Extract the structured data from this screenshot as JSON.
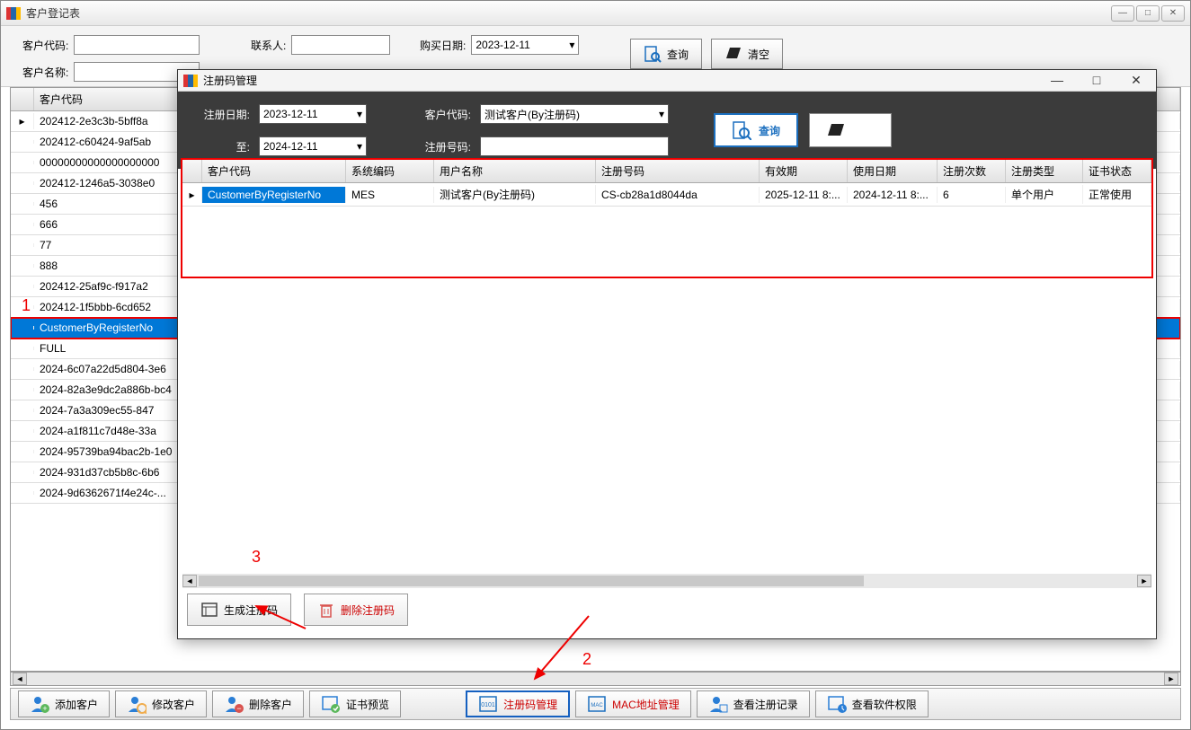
{
  "main_window": {
    "title": "客户登记表",
    "search": {
      "customer_code_label": "客户代码:",
      "contact_label": "联系人:",
      "purchase_date_label": "购买日期:",
      "purchase_date_value": "2023-12-11",
      "customer_name_label": "客户名称:",
      "query_btn": "查询",
      "clear_btn": "清空"
    },
    "grid_header": "客户代码",
    "rows": [
      "202412-2e3c3b-5bff8a",
      "202412-c60424-9af5ab",
      "00000000000000000000",
      "202412-1246a5-3038e0",
      "456",
      "666",
      "77",
      "888",
      "202412-25af9c-f917a2",
      "202412-1f5bbb-6cd652",
      "CustomerByRegisterNo",
      "FULL",
      "2024-6c07a22d5d804-3e6",
      "2024-82a3e9dc2a886b-bc4",
      "2024-7a3a309ec55-847",
      "2024-a1f811c7d48e-33a",
      "2024-95739ba94bac2b-1e0",
      "2024-931d37cb5b8c-6b6",
      "2024-9d6362671f4e24c-..."
    ],
    "selected_index": 10,
    "toolbar": {
      "add": "添加客户",
      "edit": "修改客户",
      "delete": "删除客户",
      "preview": "证书预览",
      "regcode": "注册码管理",
      "mac": "MAC地址管理",
      "viewreg": "查看注册记录",
      "viewperm": "查看软件权限"
    }
  },
  "dialog": {
    "title": "注册码管理",
    "filter": {
      "reg_date_label": "注册日期:",
      "reg_date_from": "2023-12-11",
      "to_label": "至:",
      "reg_date_to": "2024-12-11",
      "cust_code_label": "客户代码:",
      "cust_code_value": "测试客户(By注册码)",
      "reg_no_label": "注册号码:",
      "query_btn": "查询",
      "clear_btn": "清空"
    },
    "columns": {
      "c0": "客户代码",
      "c1": "系统编码",
      "c2": "用户名称",
      "c3": "注册号码",
      "c4": "有效期",
      "c5": "使用日期",
      "c6": "注册次数",
      "c7": "注册类型",
      "c8": "证书状态"
    },
    "row": {
      "c0": "CustomerByRegisterNo",
      "c1": "MES",
      "c2": "测试客户(By注册码)",
      "c3": "CS-cb28a1d8044da",
      "c4": "2025-12-11 8:...",
      "c5": "2024-12-11 8:...",
      "c6": "6",
      "c7": "单个用户",
      "c8": "正常使用"
    },
    "footer": {
      "generate": "生成注册码",
      "delete": "删除注册码"
    }
  },
  "annotations": {
    "n1": "1",
    "n2": "2",
    "n3": "3"
  }
}
